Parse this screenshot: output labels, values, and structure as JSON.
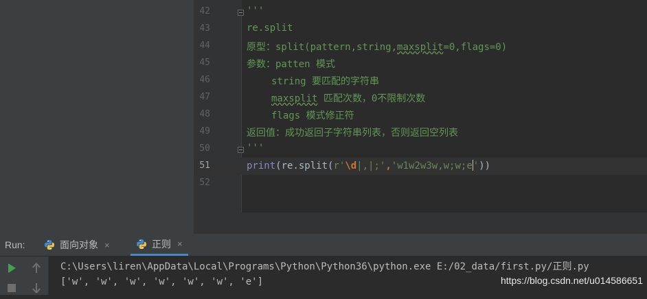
{
  "editor": {
    "lines": [
      {
        "no": "42",
        "text": "'''"
      },
      {
        "no": "43",
        "text": "re.split"
      },
      {
        "no": "44",
        "pre": "原型：split(pattern,string,",
        "wavy": "maxsplit",
        "post": "=0,flags=0)"
      },
      {
        "no": "45",
        "text": "参数：patten 模式"
      },
      {
        "no": "46",
        "text": "string 要匹配的字符串"
      },
      {
        "no": "47",
        "wavy": "maxsplit",
        "post": " 匹配次数，0不限制次数"
      },
      {
        "no": "48",
        "text": "flags 模式修正符"
      },
      {
        "no": "49",
        "text": "返回值：成功返回子字符串列表，否则返回空列表"
      },
      {
        "no": "50",
        "text": "'''"
      },
      {
        "no": "51",
        "print": "print",
        "open": "(re.split(",
        "raw_prefix": "r'",
        "esc": "\\d",
        "raw_rest": "|,|;'",
        "comma": ",",
        "str2a": "'w1w2w3w,w;w;e",
        "str2b": "'",
        "close": "))"
      },
      {
        "no": "52",
        "text": ""
      }
    ]
  },
  "run": {
    "label": "Run:",
    "tabs": [
      {
        "label": "面向对象"
      },
      {
        "label": "正则"
      }
    ],
    "close_glyph": "×",
    "console": [
      "C:\\Users\\liren\\AppData\\Local\\Programs\\Python\\Python36\\python.exe E:/02_data/first.py/正则.py",
      "['w', 'w', 'w', 'w', 'w', 'w', 'e']"
    ],
    "watermark": "https://blog.csdn.net/u014586651"
  },
  "colors": {
    "docstring": "#629755",
    "builtin": "#8888c6",
    "string": "#6a8759",
    "escape": "#cc7832",
    "run_green": "#499c54",
    "tab_accent": "#4a88c7"
  },
  "icons": [
    "python-icon",
    "run-icon",
    "stop-icon",
    "up-arrow-icon",
    "down-arrow-icon",
    "close-icon",
    "fold-icon"
  ]
}
